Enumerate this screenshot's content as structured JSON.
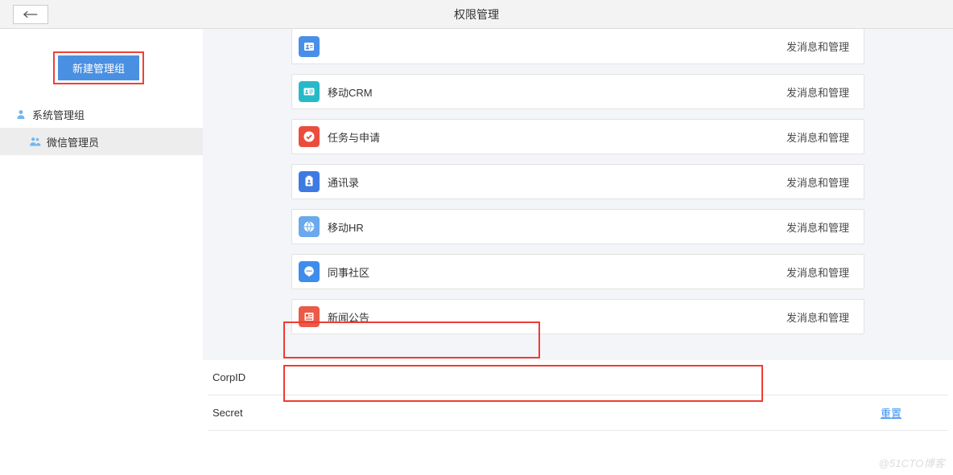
{
  "header": {
    "title": "权限管理"
  },
  "sidebar": {
    "new_group_label": "新建管理组",
    "items": [
      {
        "label": "系统管理组",
        "icon": "user-icon",
        "active": false
      },
      {
        "label": "微信管理员",
        "icon": "users-icon",
        "active": true
      }
    ]
  },
  "apps": [
    {
      "name": "",
      "perm": "发消息和管理",
      "color": "#4a8fe7",
      "icon": "contact-card-icon",
      "blurred": true
    },
    {
      "name": "移动CRM",
      "perm": "发消息和管理",
      "color": "#28b9c9",
      "icon": "id-card-icon"
    },
    {
      "name": "任务与申请",
      "perm": "发消息和管理",
      "color": "#eb4d3d",
      "icon": "check-circle-icon"
    },
    {
      "name": "通讯录",
      "perm": "发消息和管理",
      "color": "#3d7ae2",
      "icon": "book-icon"
    },
    {
      "name": "移动HR",
      "perm": "发消息和管理",
      "color": "#6aa9ec",
      "icon": "globe-icon"
    },
    {
      "name": "同事社区",
      "perm": "发消息和管理",
      "color": "#3e8ded",
      "icon": "chat-icon"
    },
    {
      "name": "新闻公告",
      "perm": "发消息和管理",
      "color": "#eb5a46",
      "icon": "news-icon"
    }
  ],
  "credentials": {
    "corpid_label": "CorpID",
    "corpid_value": "",
    "secret_label": "Secret",
    "secret_value": "",
    "reset_label": "重置"
  },
  "watermark": "@51CTO博客"
}
